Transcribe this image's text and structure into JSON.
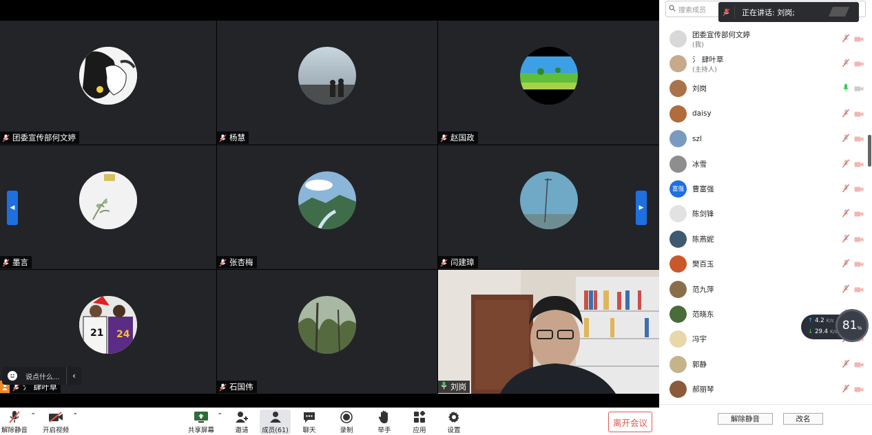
{
  "grid": {
    "tiles": [
      {
        "name": "团委宣传部何文婷"
      },
      {
        "name": "杨慧"
      },
      {
        "name": "赵国政"
      },
      {
        "name": "墨言"
      },
      {
        "name": "张杏梅"
      },
      {
        "name": "闫建璋"
      },
      {
        "name": "肆叶草",
        "prefix": "氵"
      },
      {
        "name": "石国伟"
      },
      {
        "name": "刘岗"
      }
    ],
    "chat_placeholder": "说点什么..."
  },
  "toolbar": {
    "unmute_label": "解除静音",
    "video_label": "开启视频",
    "share_label": "共享屏幕",
    "invite_label": "邀请",
    "members_label": "成员(61)",
    "chat_label": "聊天",
    "record_label": "录制",
    "raise_hand_label": "举手",
    "apps_label": "应用",
    "settings_label": "设置",
    "leave_label": "离开会议"
  },
  "panel": {
    "search_placeholder": "搜索成员",
    "speaking_label": "正在讲话: 刘岗;",
    "members": [
      {
        "name": "团委宣传部何文婷",
        "role": "(我)"
      },
      {
        "name": "氵 肆叶草",
        "role": "(主持人)"
      },
      {
        "name": "刘岗",
        "role": ""
      },
      {
        "name": "daisy",
        "role": ""
      },
      {
        "name": "szl",
        "role": ""
      },
      {
        "name": "冰雪",
        "role": ""
      },
      {
        "name": "曹富强",
        "role": "",
        "avatar_text": "富强"
      },
      {
        "name": "陈剑锋",
        "role": ""
      },
      {
        "name": "陈燕妮",
        "role": ""
      },
      {
        "name": "樊百玉",
        "role": ""
      },
      {
        "name": "范九萍",
        "role": ""
      },
      {
        "name": "范晓东",
        "role": ""
      },
      {
        "name": "冯宇",
        "role": ""
      },
      {
        "name": "郭静",
        "role": ""
      },
      {
        "name": "郝丽琴",
        "role": ""
      }
    ],
    "unmute_all_label": "解除静音",
    "rename_label": "改名"
  },
  "network": {
    "upload": "4.2",
    "download": "29.4",
    "unit": "K/s",
    "percent": "81",
    "percent_unit": "%"
  },
  "colors": {
    "accent_blue": "#1e6fe0",
    "leave_red": "#e4564f",
    "speaking_green": "#34c759",
    "tile_bg": "#232428"
  }
}
